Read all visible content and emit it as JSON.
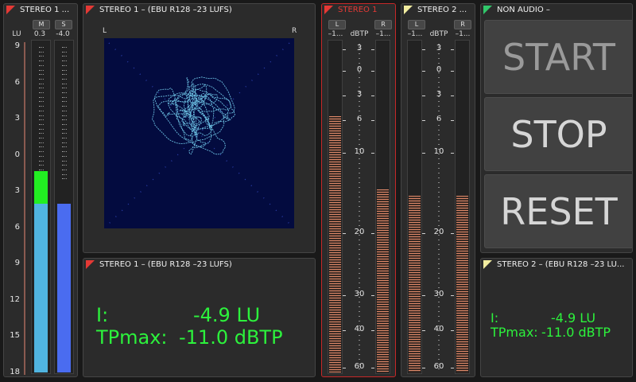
{
  "lu_panel": {
    "title": "STEREO 1 ...",
    "unit": "LU",
    "m_label": "M",
    "s_label": "S",
    "m_value": "0.3",
    "s_value": "-4.0",
    "scale": [
      "9",
      "6",
      "3",
      "0",
      "3",
      "6",
      "9",
      "12",
      "15",
      "18"
    ],
    "m_level_lu": -4.0,
    "m_peak_lu": -1.3,
    "s_level_lu": -4.0,
    "colors": {
      "m_bar": "#50b4e0",
      "m_peak": "#22ee22",
      "s_bar": "#4a6cf0"
    }
  },
  "vector_panel": {
    "title": "STEREO 1 – (EBU R128 –23 LUFS)",
    "left_label": "L",
    "right_label": "R"
  },
  "loudness_panel_1": {
    "title": "STEREO 1 – (EBU R128 –23 LUFS)",
    "i_label": "I:",
    "i_value": "-4.9 LU",
    "tp_label": "TPmax:",
    "tp_value": "-11.0 dBTP"
  },
  "tp_meter_1": {
    "title": "STEREO 1",
    "l_label": "L",
    "r_label": "R",
    "l_value": "–1...",
    "r_value": "–1...",
    "unit": "dBTP",
    "scale": [
      "3",
      "0",
      "3",
      "6",
      "10",
      "20",
      "30",
      "40",
      "60"
    ],
    "l_fill_pct": 0.77,
    "r_fill_pct": 0.55
  },
  "tp_meter_2": {
    "title": "STEREO 2 ...",
    "l_label": "L",
    "r_label": "R",
    "l_value": "–1...",
    "r_value": "–1...",
    "unit": "dBTP",
    "scale": [
      "3",
      "0",
      "3",
      "6",
      "10",
      "20",
      "30",
      "40",
      "60"
    ],
    "l_fill_pct": 0.53,
    "r_fill_pct": 0.53
  },
  "control_panel": {
    "title": "NON AUDIO –",
    "start_label": "START",
    "stop_label": "STOP",
    "reset_label": "RESET"
  },
  "loudness_panel_2": {
    "title": "STEREO 2 – (EBU R128 –23 LU...",
    "i_label": "I:",
    "i_value": "-4.9 LU",
    "tp_label": "TPmax:",
    "tp_value": "-11.0 dBTP"
  }
}
